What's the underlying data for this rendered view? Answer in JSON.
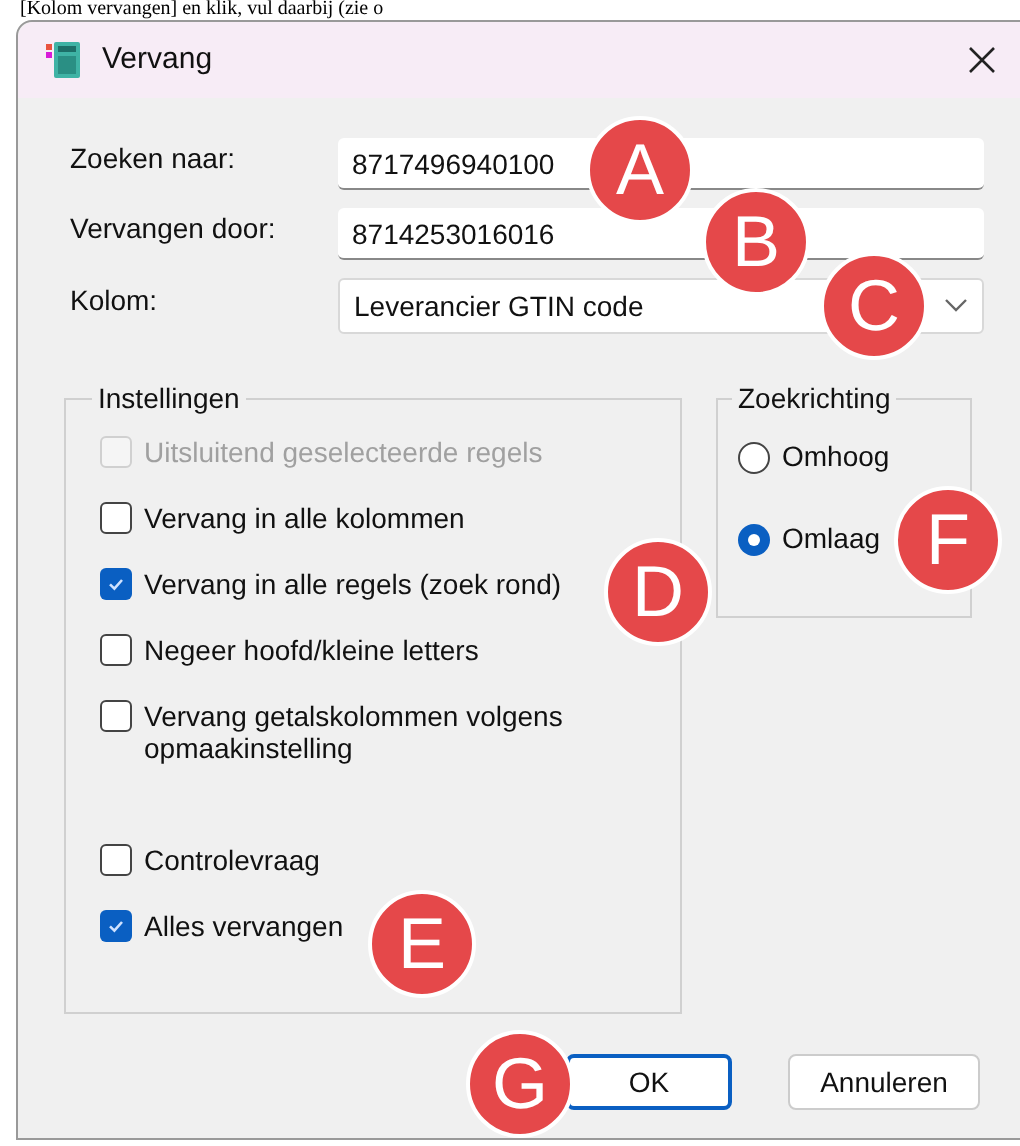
{
  "page_text": "[Kolom vervangen] en klik, vul daarbij (zie o",
  "window": {
    "title": "Vervang"
  },
  "fields": [
    {
      "kind": "text",
      "label": "Zoeken naar:",
      "value": "8717496940100"
    },
    {
      "kind": "text",
      "label": "Vervangen door:",
      "value": "8714253016016"
    },
    {
      "kind": "select",
      "label": "Kolom:",
      "value": "Leverancier GTIN code"
    }
  ],
  "settings": {
    "title": "Instellingen",
    "options": [
      {
        "label": "Uitsluitend geselecteerde regels",
        "checked": false,
        "disabled": true
      },
      {
        "label": "Vervang in alle kolommen",
        "checked": false,
        "disabled": false
      },
      {
        "label": "Vervang in alle regels (zoek rond)",
        "checked": true,
        "disabled": false
      },
      {
        "label": "Negeer hoofd/kleine letters",
        "checked": false,
        "disabled": false
      },
      {
        "label": "Vervang getalskolommen volgens opmaakinstelling",
        "checked": false,
        "disabled": false
      }
    ],
    "confirm_options": [
      {
        "label": "Controlevraag",
        "checked": false,
        "disabled": false
      },
      {
        "label": "Alles vervangen",
        "checked": true,
        "disabled": false
      }
    ]
  },
  "direction": {
    "title": "Zoekrichting",
    "options": [
      {
        "label": "Omhoog",
        "selected": false
      },
      {
        "label": "Omlaag",
        "selected": true
      }
    ]
  },
  "buttons": [
    {
      "label": "OK",
      "default": true
    },
    {
      "label": "Annuleren",
      "default": false
    }
  ],
  "callouts": [
    {
      "letter": "A"
    },
    {
      "letter": "B"
    },
    {
      "letter": "C"
    },
    {
      "letter": "D"
    },
    {
      "letter": "E"
    },
    {
      "letter": "F"
    },
    {
      "letter": "G"
    }
  ]
}
